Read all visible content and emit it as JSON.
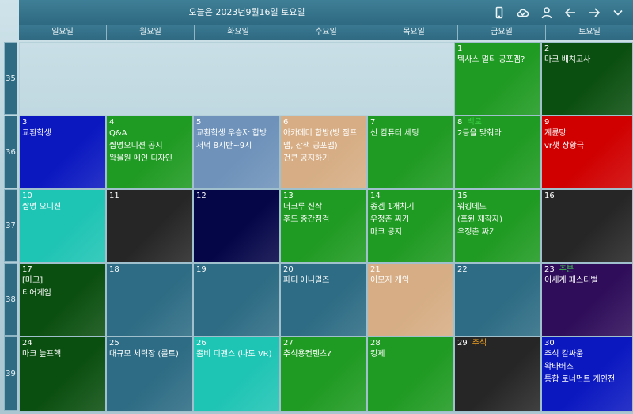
{
  "header": {
    "title": "오늘은 2023년9월16일 토요일",
    "icons": [
      "phone-icon",
      "cloud-check-icon",
      "user-icon",
      "arrow-left-icon",
      "arrow-right-icon",
      "chevron-down-icon"
    ]
  },
  "weekdays": [
    "일요일",
    "월요일",
    "화요일",
    "수요일",
    "목요일",
    "금요일",
    "토요일"
  ],
  "weeks": [
    "35",
    "36",
    "37",
    "38",
    "39"
  ],
  "colors": {
    "green": "#1f9a22",
    "darkgreen": "#0b4f10",
    "blue": "#0b18c0",
    "steel": "#6e92ba",
    "tan": "#d6ad84",
    "red": "#d00000",
    "teal": "#1ec4b4",
    "black": "#262626",
    "navy": "#050648",
    "slate": "#2d6c84",
    "purple": "#2f0d5a",
    "holiday_green": "#3fd24a",
    "holiday_orange": "#f0a020"
  },
  "cells": [
    {
      "row": 0,
      "col": 5,
      "day": "1",
      "color": "green",
      "events": [
        "텍사스 멀티 공포겜?"
      ]
    },
    {
      "row": 0,
      "col": 6,
      "day": "2",
      "color": "darkgreen",
      "events": [
        "마크 배치고사"
      ]
    },
    {
      "row": 1,
      "col": 0,
      "day": "3",
      "color": "blue",
      "events": [
        "교환학생"
      ]
    },
    {
      "row": 1,
      "col": 1,
      "day": "4",
      "color": "green",
      "events": [
        "Q&A",
        "짭명오디션 공지",
        "왁물원 메인 디자인"
      ]
    },
    {
      "row": 1,
      "col": 2,
      "day": "5",
      "color": "steel",
      "events": [
        "교환학생 우승자 합방",
        "저녁 8시반~9시"
      ]
    },
    {
      "row": 1,
      "col": 3,
      "day": "6",
      "color": "tan",
      "events": [
        "아카데미 합방(방 점프",
        "맵, 산책 공포맵)",
        "건콘 공지하기"
      ]
    },
    {
      "row": 1,
      "col": 4,
      "day": "7",
      "color": "green",
      "events": [
        "신 컴퓨터 세팅"
      ]
    },
    {
      "row": 1,
      "col": 5,
      "day": "8",
      "holiday": "백로",
      "holiday_color": "holiday_green",
      "color": "green",
      "events": [
        "2등을 맞춰라"
      ]
    },
    {
      "row": 1,
      "col": 6,
      "day": "9",
      "color": "red",
      "events": [
        "계륜탕",
        "vr챗 상황극"
      ]
    },
    {
      "row": 2,
      "col": 0,
      "day": "10",
      "color": "teal",
      "events": [
        "짭명 오디션"
      ]
    },
    {
      "row": 2,
      "col": 1,
      "day": "11",
      "color": "black",
      "events": []
    },
    {
      "row": 2,
      "col": 2,
      "day": "12",
      "color": "navy",
      "events": []
    },
    {
      "row": 2,
      "col": 3,
      "day": "13",
      "color": "green",
      "events": [
        "더크루 신작",
        "후드 중간점검"
      ]
    },
    {
      "row": 2,
      "col": 4,
      "day": "14",
      "color": "green",
      "events": [
        "종겜 1개치기",
        "우정촌 짜기",
        "마크 공지"
      ]
    },
    {
      "row": 2,
      "col": 5,
      "day": "15",
      "color": "green",
      "events": [
        "워킹데드",
        "(프윈 제작자)",
        "우정촌 짜기"
      ]
    },
    {
      "row": 2,
      "col": 6,
      "day": "16",
      "color": "black",
      "events": []
    },
    {
      "row": 3,
      "col": 0,
      "day": "17",
      "color": "darkgreen",
      "events": [
        "[마크]",
        "티어게임"
      ]
    },
    {
      "row": 3,
      "col": 1,
      "day": "18",
      "color": "slate",
      "events": []
    },
    {
      "row": 3,
      "col": 2,
      "day": "19",
      "color": "slate",
      "events": []
    },
    {
      "row": 3,
      "col": 3,
      "day": "20",
      "color": "slate",
      "events": [
        "파티 애니멀즈"
      ]
    },
    {
      "row": 3,
      "col": 4,
      "day": "21",
      "color": "tan",
      "events": [
        "이모지 게임"
      ]
    },
    {
      "row": 3,
      "col": 5,
      "day": "22",
      "color": "slate",
      "events": []
    },
    {
      "row": 3,
      "col": 6,
      "day": "23",
      "holiday": "추분",
      "holiday_color": "holiday_green",
      "color": "purple",
      "events": [
        "이세계 페스티벌"
      ]
    },
    {
      "row": 4,
      "col": 0,
      "day": "24",
      "color": "darkgreen",
      "events": [
        "마크 늪프핵"
      ]
    },
    {
      "row": 4,
      "col": 1,
      "day": "25",
      "color": "slate",
      "events": [
        "대규모 체력장 (룰트)"
      ]
    },
    {
      "row": 4,
      "col": 2,
      "day": "26",
      "color": "teal",
      "events": [
        "좀비 디펜스 (나도 VR)"
      ]
    },
    {
      "row": 4,
      "col": 3,
      "day": "27",
      "color": "green",
      "events": [
        "추석용컨텐츠?"
      ]
    },
    {
      "row": 4,
      "col": 4,
      "day": "28",
      "color": "green",
      "events": [
        "킹제"
      ]
    },
    {
      "row": 4,
      "col": 5,
      "day": "29",
      "holiday": "추석",
      "holiday_color": "holiday_orange",
      "color": "black",
      "events": []
    },
    {
      "row": 4,
      "col": 6,
      "day": "30",
      "color": "blue",
      "events": [
        "추석 칼싸움",
        "왁타버스",
        "통합 토너먼트 개인전"
      ]
    }
  ]
}
